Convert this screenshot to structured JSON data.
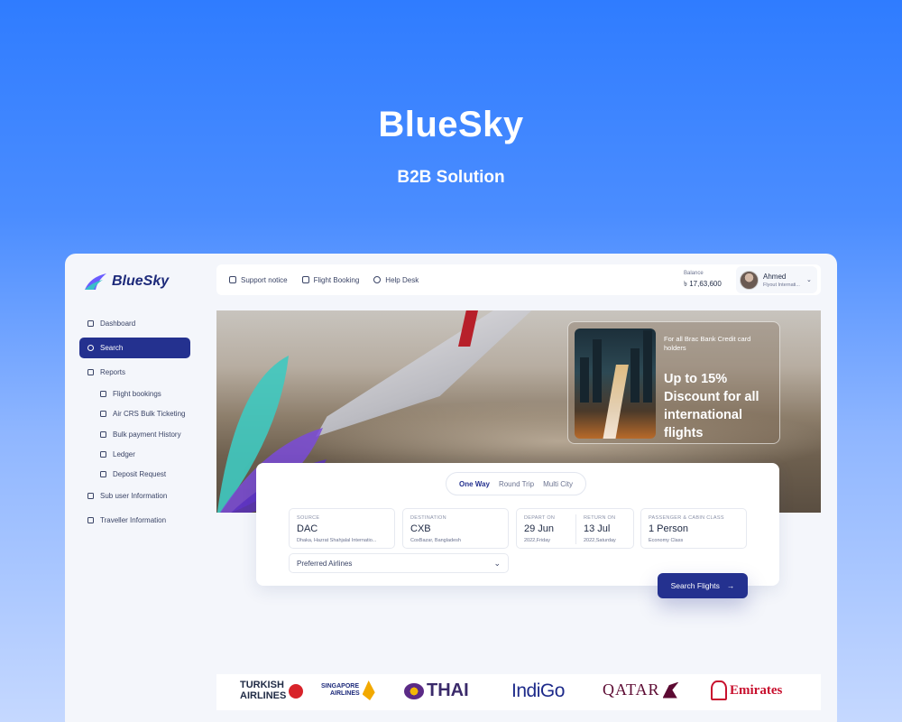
{
  "hero": {
    "title": "BlueSky",
    "subtitle": "B2B Solution"
  },
  "app": {
    "logo_text": "BlueSky"
  },
  "sidebar": {
    "items": [
      {
        "label": "Dashboard",
        "icon": "grid-icon"
      },
      {
        "label": "Search",
        "icon": "search-icon",
        "active": true
      },
      {
        "label": "Reports",
        "icon": "chart-icon"
      },
      {
        "label": "Flight bookings",
        "icon": "plane-icon"
      },
      {
        "label": "Air CRS Bulk Ticketing",
        "icon": "ticket-icon"
      },
      {
        "label": "Bulk payment History",
        "icon": "swap-icon"
      },
      {
        "label": "Ledger",
        "icon": "book-icon"
      },
      {
        "label": "Deposit Request",
        "icon": "document-icon"
      },
      {
        "label": "Sub user Information",
        "icon": "chart-icon"
      },
      {
        "label": "Traveller Information",
        "icon": "chart-icon"
      }
    ]
  },
  "topbar": {
    "links": [
      {
        "label": "Support notice",
        "icon": "megaphone-icon"
      },
      {
        "label": "Flight Booking",
        "icon": "plane-icon"
      },
      {
        "label": "Help Desk",
        "icon": "headset-icon"
      }
    ],
    "balance_label": "Balance",
    "balance_value": "৳ 17,63,600",
    "user_name": "Ahmed",
    "user_org": "Flyout Internati..."
  },
  "promo": {
    "small": "For all Brac Bank Credit card holders",
    "big": "Up to 15% Discount for all international flights"
  },
  "search": {
    "tabs": [
      "One Way",
      "Round Trip",
      "Multi City"
    ],
    "active_tab": "One Way",
    "source": {
      "label": "SOURCE",
      "code": "DAC",
      "detail": "Dhaka, Hazrat Shahjalal Internatio..."
    },
    "destination": {
      "label": "DESTINATION",
      "code": "CXB",
      "detail": "CoxBazar, Bangladesh"
    },
    "depart": {
      "label": "DEPART ON",
      "date": "29 Jun",
      "detail": "2022,Friday"
    },
    "return": {
      "label": "RETURN ON",
      "date": "13 Jul",
      "detail": "2022,Saturday"
    },
    "passenger": {
      "label": "PASSENGER & CABIN CLASS",
      "value": "1 Person",
      "detail": "Economy Class"
    },
    "preferred_airlines": "Preferred Airlines",
    "button": "Search Flights"
  },
  "airlines": {
    "turkish_1": "TURKISH",
    "turkish_2": "AIRLINES",
    "singapore_1": "SINGAPORE",
    "singapore_2": "AIRLINES",
    "thai": "THAI",
    "indigo": "IndiGo",
    "qatar": "QATAR",
    "emirates": "Emirates"
  },
  "colors": {
    "primary": "#24318f",
    "background_top": "#2f7cff",
    "promo_text": "#ffffff"
  }
}
